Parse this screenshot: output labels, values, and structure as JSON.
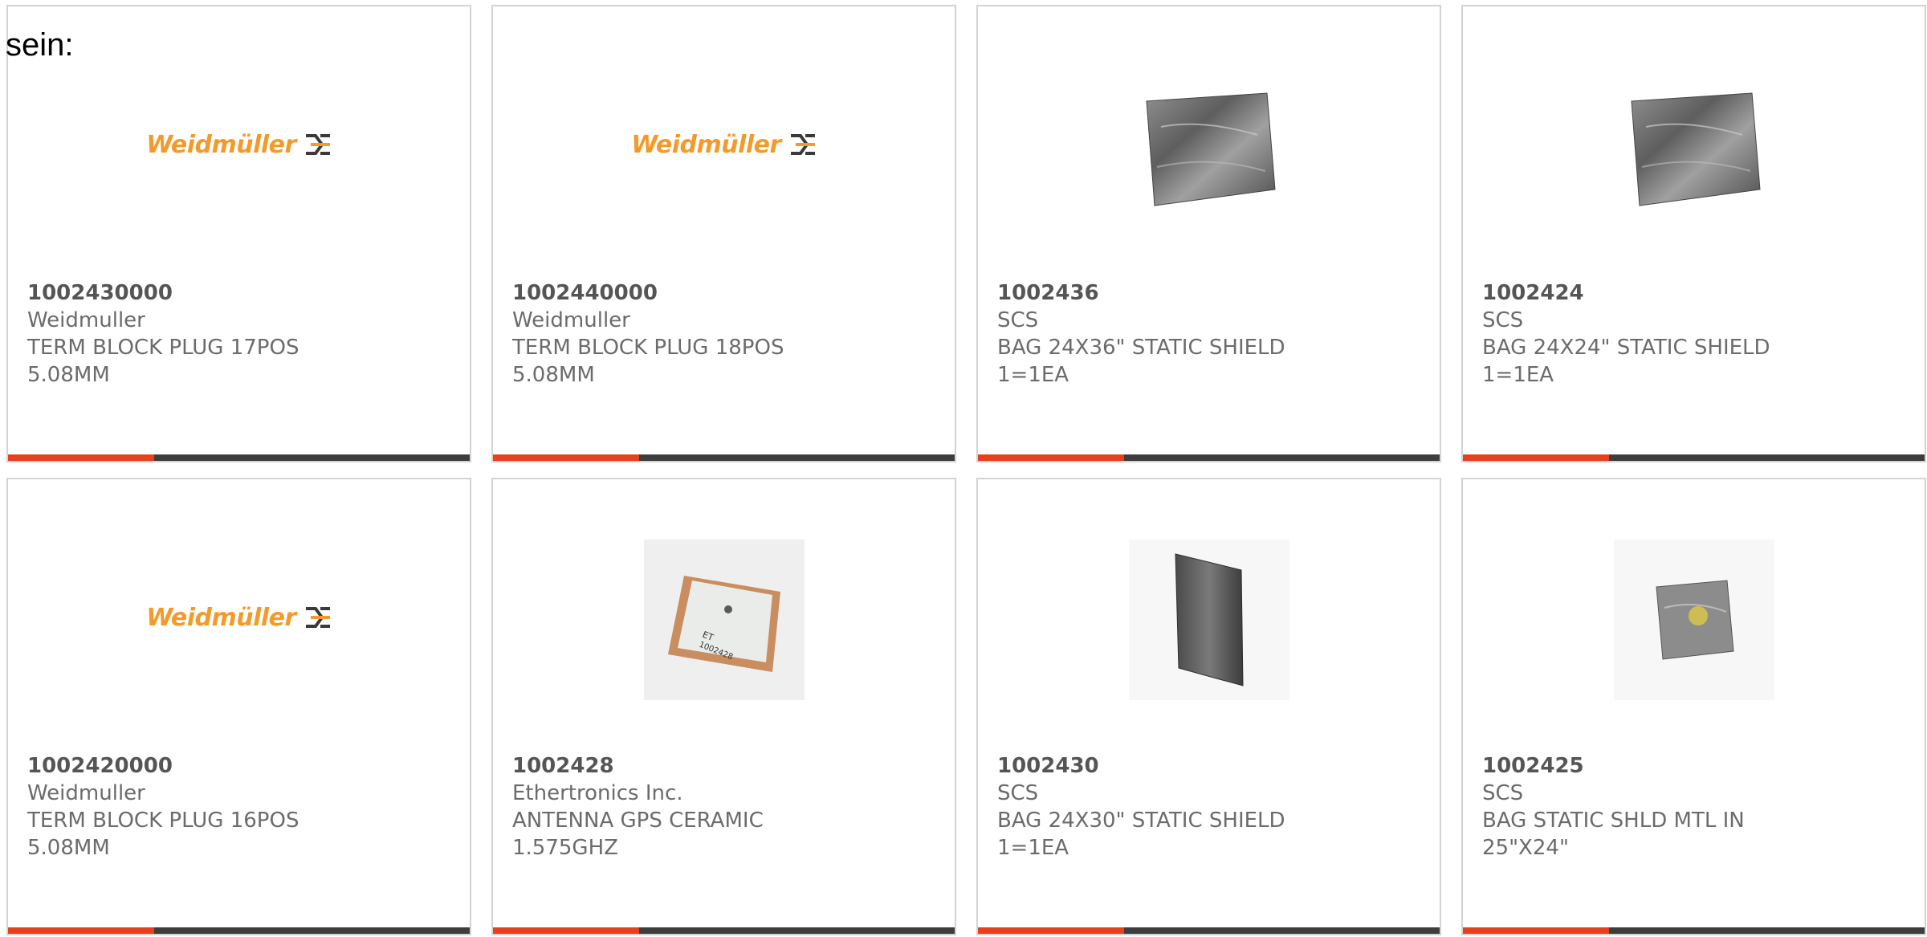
{
  "intro_text": "sein:",
  "colors": {
    "accent_bar": "#e8401c",
    "dark_bar": "#3d3d3d",
    "logo_orange": "#f39a2b",
    "logo_mark": "#3a3a3a"
  },
  "logo": {
    "text": "Weidmüller",
    "mark": "Ͽ"
  },
  "products": [
    {
      "part_no": "1002430000",
      "manufacturer": "Weidmuller",
      "desc_line1": "TERM BLOCK PLUG 17POS",
      "desc_line2": "5.08MM",
      "image": "weidmuller-logo"
    },
    {
      "part_no": "1002440000",
      "manufacturer": "Weidmuller",
      "desc_line1": "TERM BLOCK PLUG 18POS",
      "desc_line2": "5.08MM",
      "image": "weidmuller-logo"
    },
    {
      "part_no": "1002436",
      "manufacturer": "SCS",
      "desc_line1": "BAG 24X36\" STATIC SHIELD",
      "desc_line2": "1=1EA",
      "image": "static-bag-flat"
    },
    {
      "part_no": "1002424",
      "manufacturer": "SCS",
      "desc_line1": "BAG 24X24\" STATIC SHIELD",
      "desc_line2": "1=1EA",
      "image": "static-bag-flat"
    },
    {
      "part_no": "1002420000",
      "manufacturer": "Weidmuller",
      "desc_line1": "TERM BLOCK PLUG 16POS",
      "desc_line2": "5.08MM",
      "image": "weidmuller-logo"
    },
    {
      "part_no": "1002428",
      "manufacturer": "Ethertronics Inc.",
      "desc_line1": "ANTENNA GPS CERAMIC",
      "desc_line2": "1.575GHZ",
      "image": "ceramic-antenna"
    },
    {
      "part_no": "1002430",
      "manufacturer": "SCS",
      "desc_line1": "BAG 24X30\" STATIC SHIELD",
      "desc_line2": "1=1EA",
      "image": "static-bag-standing"
    },
    {
      "part_no": "1002425",
      "manufacturer": "SCS",
      "desc_line1": "BAG STATIC SHLD MTL IN",
      "desc_line2": "25\"X24\"",
      "image": "static-bag-small"
    }
  ]
}
